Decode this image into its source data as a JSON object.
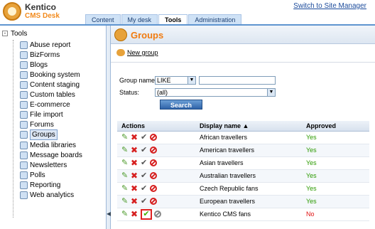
{
  "header": {
    "brand_line1": "Kentico",
    "brand_line2": "CMS Desk",
    "switch_link": "Switch to Site Manager",
    "tabs": [
      {
        "label": "Content",
        "active": false
      },
      {
        "label": "My desk",
        "active": false
      },
      {
        "label": "Tools",
        "active": true
      },
      {
        "label": "Administration",
        "active": false
      }
    ]
  },
  "sidebar": {
    "root": "Tools",
    "root_toggle": "-",
    "items": [
      {
        "label": "Abuse report",
        "icon": "abuse-report-icon",
        "selected": false
      },
      {
        "label": "BizForms",
        "icon": "bizforms-icon",
        "selected": false
      },
      {
        "label": "Blogs",
        "icon": "blogs-icon",
        "selected": false
      },
      {
        "label": "Booking system",
        "icon": "booking-icon",
        "selected": false
      },
      {
        "label": "Content staging",
        "icon": "staging-icon",
        "selected": false
      },
      {
        "label": "Custom tables",
        "icon": "custom-tables-icon",
        "selected": false
      },
      {
        "label": "E-commerce",
        "icon": "ecommerce-icon",
        "selected": false
      },
      {
        "label": "File import",
        "icon": "file-import-icon",
        "selected": false
      },
      {
        "label": "Forums",
        "icon": "forums-icon",
        "selected": false
      },
      {
        "label": "Groups",
        "icon": "groups-icon",
        "selected": true
      },
      {
        "label": "Media libraries",
        "icon": "media-icon",
        "selected": false
      },
      {
        "label": "Message boards",
        "icon": "message-boards-icon",
        "selected": false
      },
      {
        "label": "Newsletters",
        "icon": "newsletters-icon",
        "selected": false
      },
      {
        "label": "Polls",
        "icon": "polls-icon",
        "selected": false
      },
      {
        "label": "Reporting",
        "icon": "reporting-icon",
        "selected": false
      },
      {
        "label": "Web analytics",
        "icon": "web-analytics-icon",
        "selected": false
      }
    ]
  },
  "main": {
    "title": "Groups",
    "new_group": "New group",
    "filter": {
      "group_name_label": "Group name:",
      "group_name_operator": "LIKE",
      "group_name_value": "",
      "status_label": "Status:",
      "status_value": "(all)",
      "search_button": "Search"
    },
    "grid": {
      "columns": {
        "actions": "Actions",
        "display_name": "Display name ▲",
        "approved": "Approved"
      },
      "rows": [
        {
          "name": "African travellers",
          "approved": "Yes"
        },
        {
          "name": "American travellers",
          "approved": "Yes"
        },
        {
          "name": "Asian travellers",
          "approved": "Yes"
        },
        {
          "name": "Australian travellers",
          "approved": "Yes"
        },
        {
          "name": "Czech Republic fans",
          "approved": "Yes"
        },
        {
          "name": "European travellers",
          "approved": "Yes"
        },
        {
          "name": "Kentico CMS fans",
          "approved": "No"
        }
      ]
    }
  },
  "colors": {
    "accent": "#f17b10",
    "yes": "#2b9a00",
    "no": "#e01010",
    "nav_blue": "#5f95d0"
  }
}
